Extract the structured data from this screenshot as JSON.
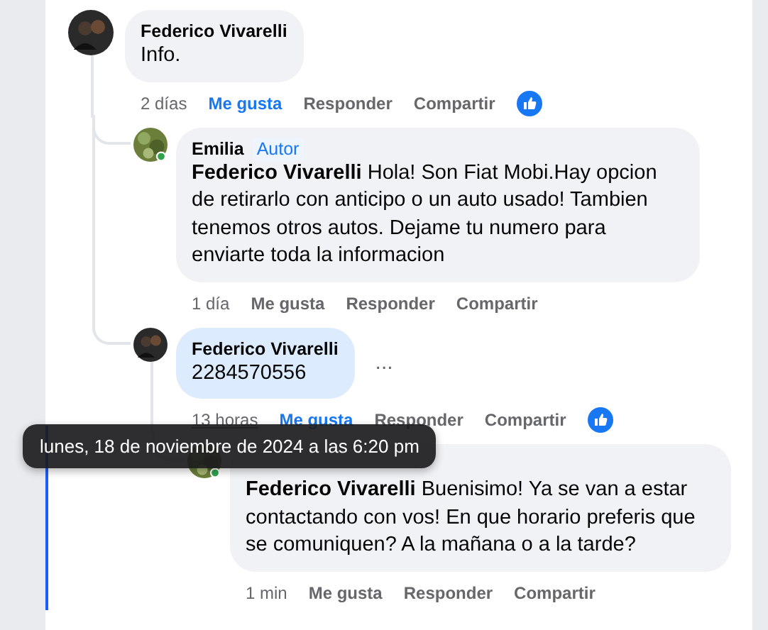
{
  "comments": [
    {
      "author": "Federico Vivarelli",
      "text": "Info.",
      "time": "2 días",
      "like": "Me gusta",
      "liked": true,
      "reply": "Responder",
      "share": "Compartir",
      "reaction": true,
      "highlighted": false,
      "children": [
        {
          "author": "Emilia",
          "badge": "Autor",
          "online": true,
          "text": "**Federico Vivarelli** Hola! Son Fiat Mobi.Hay opcion de retirarlo con anticipo o un auto usado! Tambien tenemos otros autos. Dejame tu numero para enviarte toda la informacion",
          "time": "1 día",
          "like": "Me gusta",
          "liked": false,
          "reply": "Responder",
          "share": "Compartir",
          "reaction": false,
          "highlighted": false
        },
        {
          "author": "Federico Vivarelli",
          "text": "2284570556",
          "more": "...",
          "time": "13 horas",
          "time_hovered": true,
          "like": "Me gusta",
          "liked": true,
          "reply": "Responder",
          "share": "Compartir",
          "reaction": true,
          "highlighted": true,
          "children": [
            {
              "online": true,
              "text": "**Federico Vivarelli** Buenisimo! Ya se van a estar contactando con vos! En que horario preferis que se comuniquen? A la mañana o a la tarde?",
              "time": "1 min",
              "like": "Me gusta",
              "liked": false,
              "reply": "Responder",
              "share": "Compartir",
              "reaction": false,
              "highlighted": false
            }
          ]
        }
      ]
    }
  ],
  "tooltip": {
    "text": "lunes, 18 de noviembre de 2024 a las 6:20 pm"
  }
}
